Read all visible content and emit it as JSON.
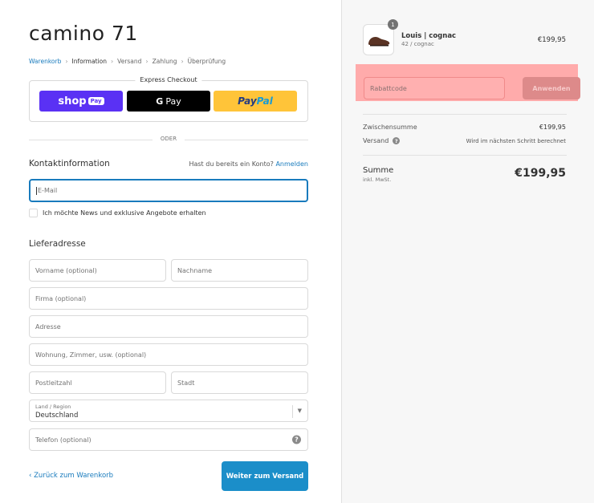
{
  "brand": {
    "logo": "camino 71"
  },
  "breadcrumb": {
    "items": [
      {
        "label": "Warenkorb",
        "state": "link"
      },
      {
        "label": "Information",
        "state": "current"
      },
      {
        "label": "Versand",
        "state": "upcoming"
      },
      {
        "label": "Zahlung",
        "state": "upcoming"
      },
      {
        "label": "Überprüfung",
        "state": "upcoming"
      }
    ]
  },
  "express": {
    "title": "Express Checkout",
    "shop_pay": {
      "shop": "shop",
      "pay": "Pay"
    },
    "gpay": {
      "g": "G",
      "pay": "Pay"
    },
    "paypal": {
      "pay": "Pay",
      "pal": "Pal"
    }
  },
  "divider": "ODER",
  "contact": {
    "title": "Kontaktinformation",
    "login_prompt": "Hast du bereits ein Konto?",
    "login_link": "Anmelden",
    "email_placeholder": "E-Mail",
    "newsletter_label": "Ich möchte News und exklusive Angebote erhalten"
  },
  "shipping": {
    "title": "Lieferadresse",
    "first_name": "Vorname (optional)",
    "last_name": "Nachname",
    "company": "Firma (optional)",
    "address": "Adresse",
    "apartment": "Wohnung, Zimmer, usw. (optional)",
    "zip": "Postleitzahl",
    "city": "Stadt",
    "country_label": "Land / Region",
    "country_value": "Deutschland",
    "phone": "Telefon (optional)"
  },
  "actions": {
    "back": "Zurück zum Warenkorb",
    "continue": "Weiter zum Versand"
  },
  "cart": {
    "item": {
      "quantity": "1",
      "name": "Louis | cognac",
      "variant": "42 / cognac",
      "price": "€199,95"
    },
    "promo": {
      "placeholder": "Rabattcode",
      "button": "Anwenden"
    },
    "subtotal_label": "Zwischensumme",
    "subtotal_value": "€199,95",
    "shipping_label": "Versand",
    "shipping_value": "Wird im nächsten Schritt berechnet",
    "total_label": "Summe",
    "total_sub": "inkl. MwSt.",
    "total_value": "€199,95"
  },
  "colors": {
    "accent": "#197bbd",
    "button": "#1b8ec9",
    "promo_highlight": "#ffabab",
    "shop_pay": "#5a31f4",
    "paypal": "#ffc439"
  }
}
